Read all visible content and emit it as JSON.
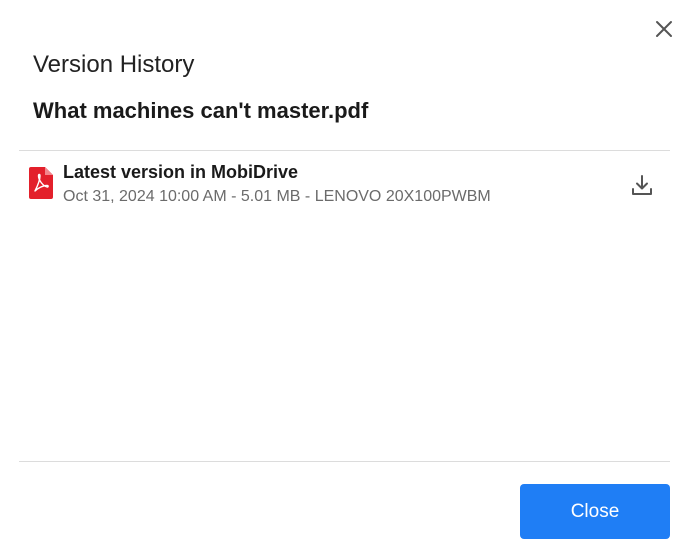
{
  "dialog": {
    "title": "Version History",
    "filename": "What machines can't master.pdf",
    "close_icon": "close-icon"
  },
  "versions": [
    {
      "label": "Latest version in MobiDrive",
      "meta": "Oct 31, 2024 10:00 AM - 5.01 MB - LENOVO 20X100PWBM",
      "file_icon": "pdf-file-icon",
      "action_icon": "download-icon"
    }
  ],
  "footer": {
    "close_label": "Close"
  },
  "colors": {
    "accent": "#1f7ef5",
    "pdf_red": "#e3202b",
    "divider": "#dcdcdc"
  }
}
